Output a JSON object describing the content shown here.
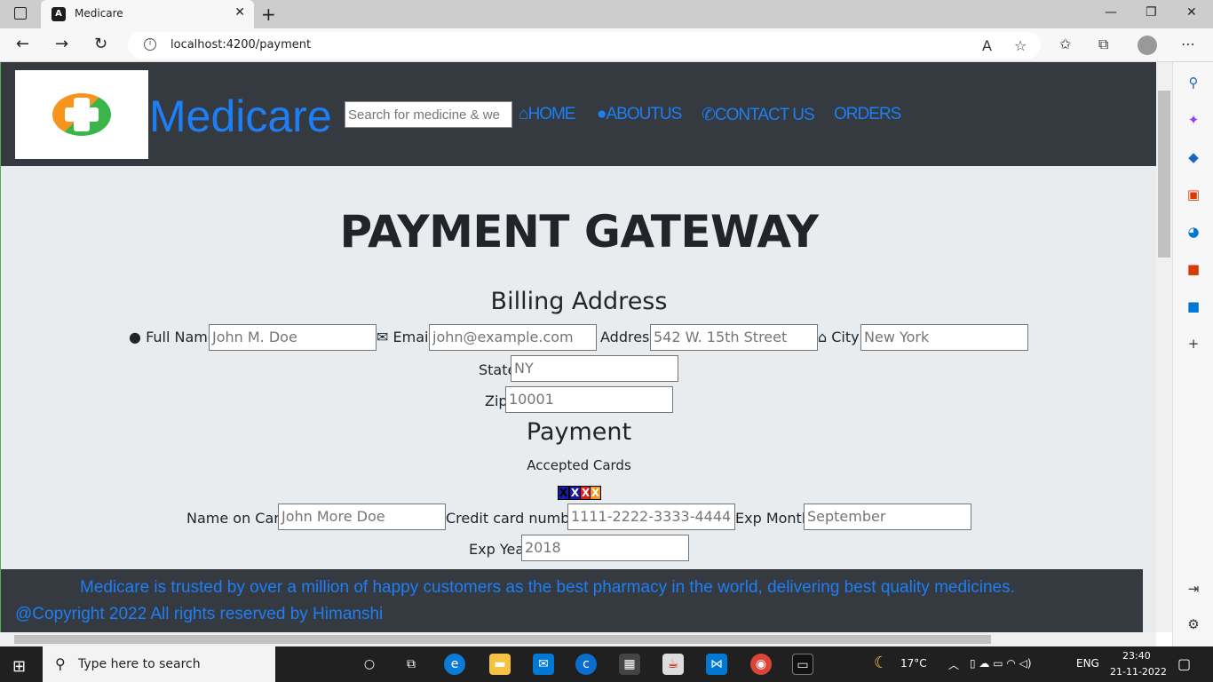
{
  "browser": {
    "tab_title": "Medicare",
    "tab_favicon": "A",
    "url": "localhost:4200/payment",
    "new_tab": "+",
    "tab_close": "✕"
  },
  "header": {
    "brand": "Medicare",
    "search_placeholder": "Search for medicine & we",
    "nav": [
      {
        "label": "HOME",
        "icon": "home-icon"
      },
      {
        "label": "ABOUTUS",
        "icon": "user-icon"
      },
      {
        "label": "CONTACT US",
        "icon": "phone-icon"
      },
      {
        "label": "ORDERS",
        "icon": ""
      }
    ]
  },
  "page": {
    "title": "PAYMENT GATEWAY",
    "billing_heading": "Billing Address",
    "billing": {
      "full_name_label": "Full Name",
      "full_name_placeholder": "John M. Doe",
      "email_label": "Email",
      "email_placeholder": "john@example.com",
      "address_label": "Address",
      "address_placeholder": "542 W. 15th Street",
      "city_label": "City",
      "city_placeholder": "New York",
      "state_label": "State",
      "state_placeholder": "NY",
      "zip_label": "Zip",
      "zip_placeholder": "10001"
    },
    "payment_heading": "Payment",
    "accepted_cards": "Accepted Cards",
    "cards": [
      "visa",
      "amex",
      "mastercard",
      "discover"
    ],
    "payment": {
      "name_on_card_label": "Name on Card",
      "name_on_card_placeholder": "John More Doe",
      "card_number_label": "Credit card number",
      "card_number_placeholder": "1111-2222-3333-4444",
      "exp_month_label": "Exp Month",
      "exp_month_placeholder": "September",
      "exp_year_label": "Exp Year",
      "exp_year_placeholder": "2018"
    }
  },
  "footer": {
    "tagline": "Medicare is trusted by over a million of happy customers as the best pharmacy in the world, delivering best quality medicines.",
    "copyright": "@Copyright 2022 All rights reserved by Himanshi"
  },
  "taskbar": {
    "search_placeholder": "Type here to search",
    "weather": "17°C",
    "language": "ENG",
    "time": "23:40",
    "date": "21-11-2022"
  },
  "colors": {
    "accent": "#1e7ef6",
    "header_bg": "#343a40",
    "page_bg": "#e9ecef"
  }
}
